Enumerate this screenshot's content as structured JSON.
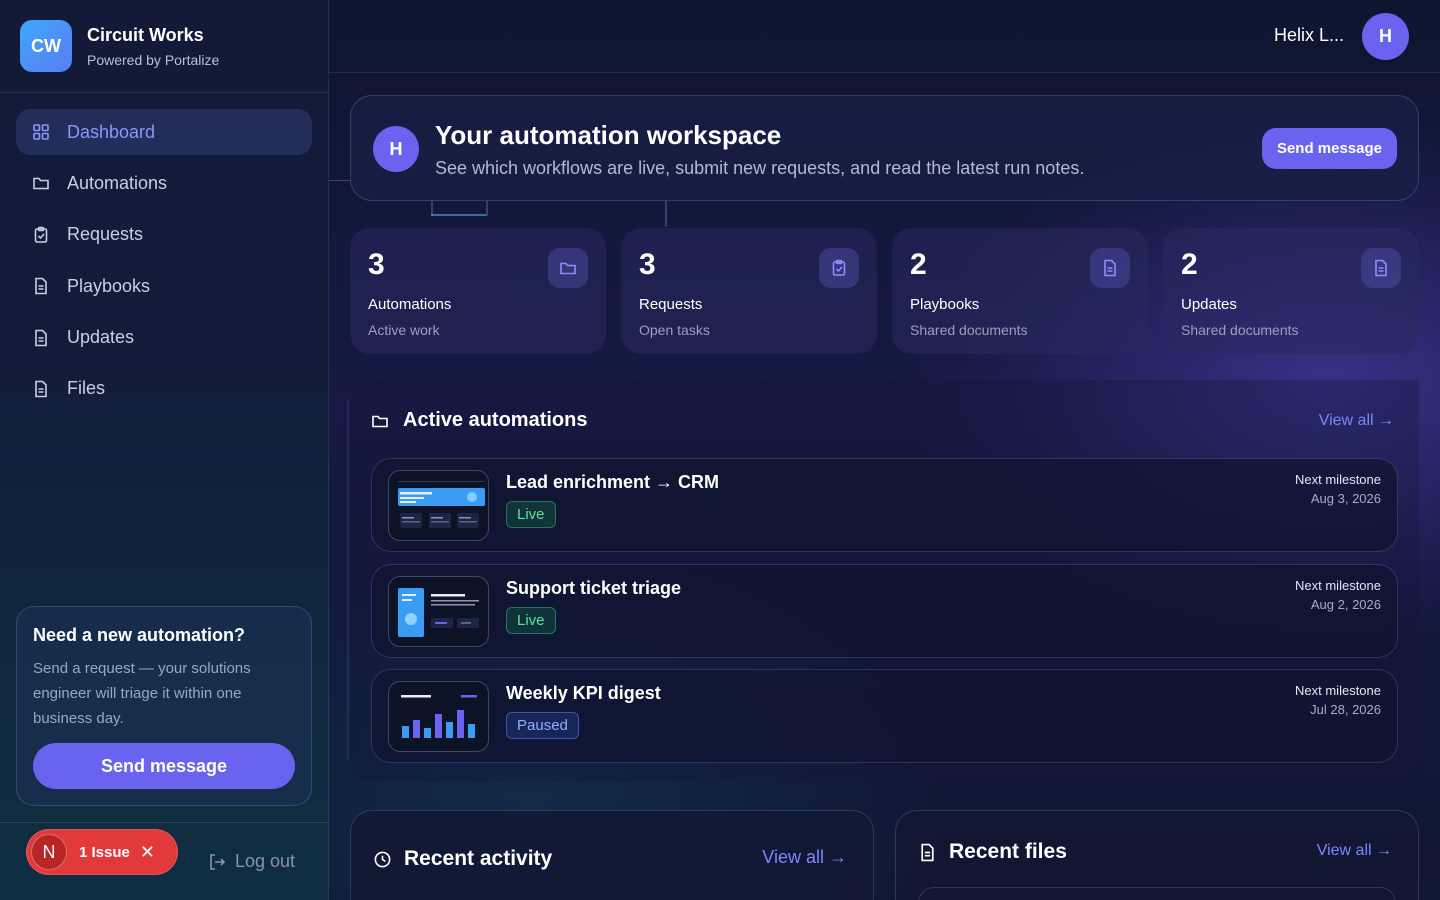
{
  "brand": {
    "logo_text": "CW",
    "name": "Circuit Works",
    "subtitle": "Powered by Portalize"
  },
  "sidebar": {
    "items": [
      {
        "label": "Dashboard",
        "icon": "grid-icon",
        "active": true
      },
      {
        "label": "Automations",
        "icon": "folder-icon"
      },
      {
        "label": "Requests",
        "icon": "clipboard-icon"
      },
      {
        "label": "Playbooks",
        "icon": "document-icon"
      },
      {
        "label": "Updates",
        "icon": "document-icon"
      },
      {
        "label": "Files",
        "icon": "document-icon"
      }
    ],
    "cta": {
      "title": "Need a new automation?",
      "text": "Send a request — your solutions engineer will triage it within one business day.",
      "button": "Send message"
    },
    "issue": {
      "avatar": "N",
      "label": "1 Issue",
      "close": "✕"
    },
    "logout": "Log out"
  },
  "user": {
    "name": "Helix L...",
    "initial": "H"
  },
  "hero": {
    "initial": "H",
    "title": "Your automation workspace",
    "subtitle": "See which workflows are live, submit new requests, and read the latest run notes.",
    "button": "Send message"
  },
  "stats": [
    {
      "value": "3",
      "title": "Automations",
      "subtitle": "Active work",
      "icon": "folder-icon"
    },
    {
      "value": "3",
      "title": "Requests",
      "subtitle": "Open tasks",
      "icon": "clipboard-icon"
    },
    {
      "value": "2",
      "title": "Playbooks",
      "subtitle": "Shared documents",
      "icon": "document-icon"
    },
    {
      "value": "2",
      "title": "Updates",
      "subtitle": "Shared documents",
      "icon": "document-icon"
    }
  ],
  "automations": {
    "title": "Active automations",
    "view_all": "View all →",
    "milestone_label": "Next milestone",
    "items": [
      {
        "name": "Lead enrichment → CRM",
        "status": "Live",
        "date": "Aug 3, 2026"
      },
      {
        "name": "Support ticket triage",
        "status": "Live",
        "date": "Aug 2, 2026"
      },
      {
        "name": "Weekly KPI digest",
        "status": "Paused",
        "date": "Jul 28, 2026"
      }
    ]
  },
  "recent_activity": {
    "title": "Recent activity",
    "view_all": "View all →"
  },
  "recent_files": {
    "title": "Recent files",
    "view_all": "View all →"
  },
  "colors": {
    "accent": "#6a63f0",
    "live": "#5fe0a0",
    "paused": "#8fb0ff",
    "issue": "#e23a3a"
  }
}
